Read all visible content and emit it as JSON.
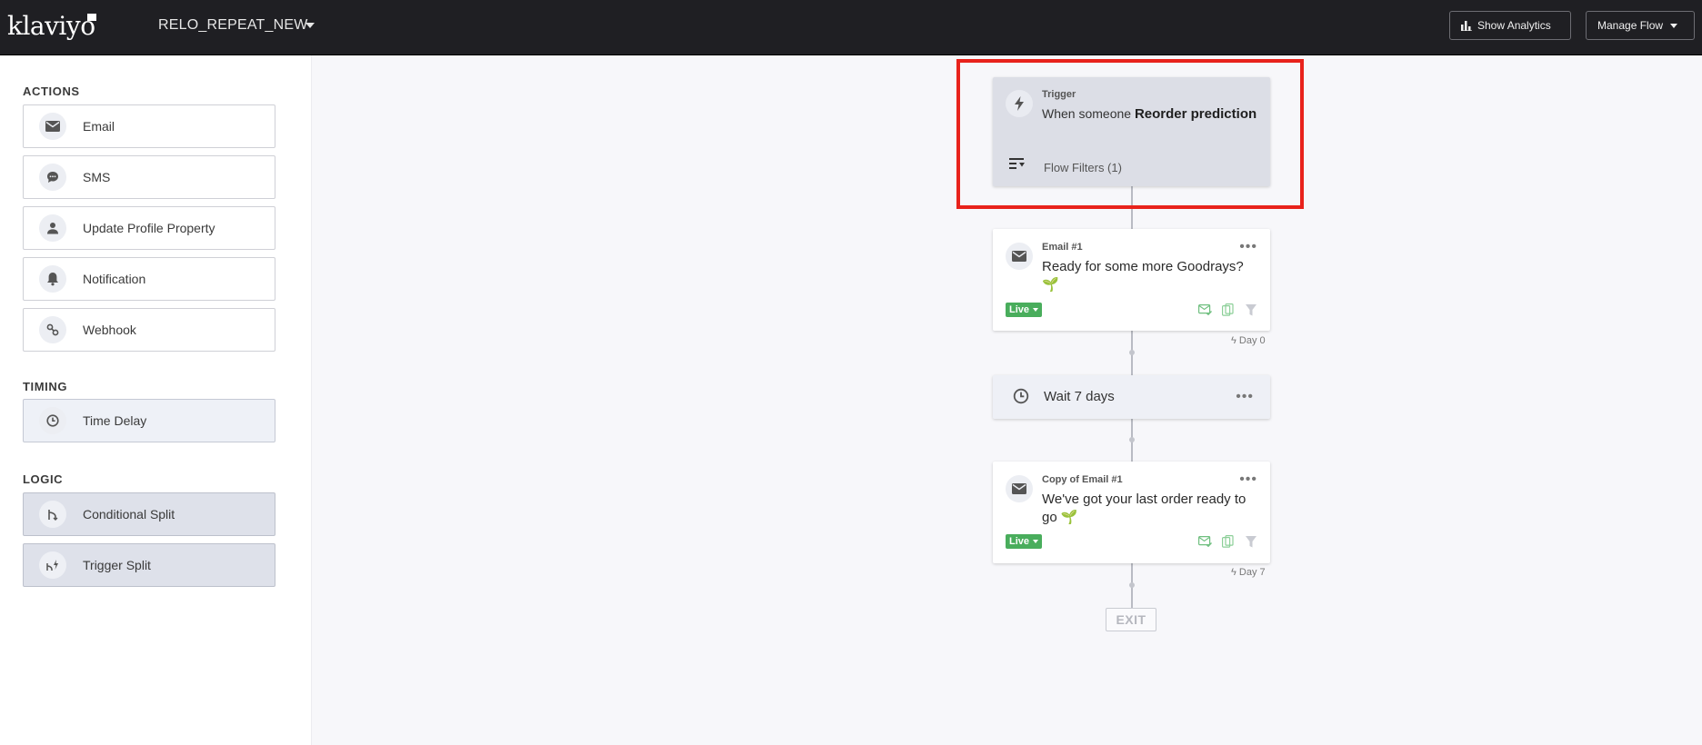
{
  "header": {
    "logo": "klaviyo",
    "flow_name": "RELO_REPEAT_NEW",
    "show_analytics": "Show Analytics",
    "manage_flow": "Manage Flow"
  },
  "sidebar": {
    "actions_title": "ACTIONS",
    "actions": [
      {
        "label": "Email",
        "icon": "envelope-icon"
      },
      {
        "label": "SMS",
        "icon": "chat-icon"
      },
      {
        "label": "Update Profile Property",
        "icon": "person-icon"
      },
      {
        "label": "Notification",
        "icon": "bell-icon"
      },
      {
        "label": "Webhook",
        "icon": "webhook-icon"
      }
    ],
    "timing_title": "TIMING",
    "timing": [
      {
        "label": "Time Delay",
        "icon": "clock-icon"
      }
    ],
    "logic_title": "LOGIC",
    "logic": [
      {
        "label": "Conditional Split",
        "icon": "split-icon"
      },
      {
        "label": "Trigger Split",
        "icon": "trigger-split-icon"
      }
    ]
  },
  "flow": {
    "trigger": {
      "title": "Trigger",
      "prefix": "When someone",
      "event": "Reorder prediction",
      "filters": "Flow Filters (1)"
    },
    "email1": {
      "title": "Email #1",
      "subject": "Ready for some more Goodrays?",
      "emoji": "🌱",
      "status": "Live",
      "day": "Day 0"
    },
    "wait": {
      "text": "Wait 7 days"
    },
    "email2": {
      "title": "Copy of Email #1",
      "subject": "We've got your last order ready to go",
      "emoji": "🌱",
      "status": "Live",
      "day": "Day 7"
    },
    "exit": "EXIT"
  },
  "colors": {
    "topbar": "#1f1f23",
    "live": "#49ad5c",
    "highlight": "#e8221b"
  }
}
